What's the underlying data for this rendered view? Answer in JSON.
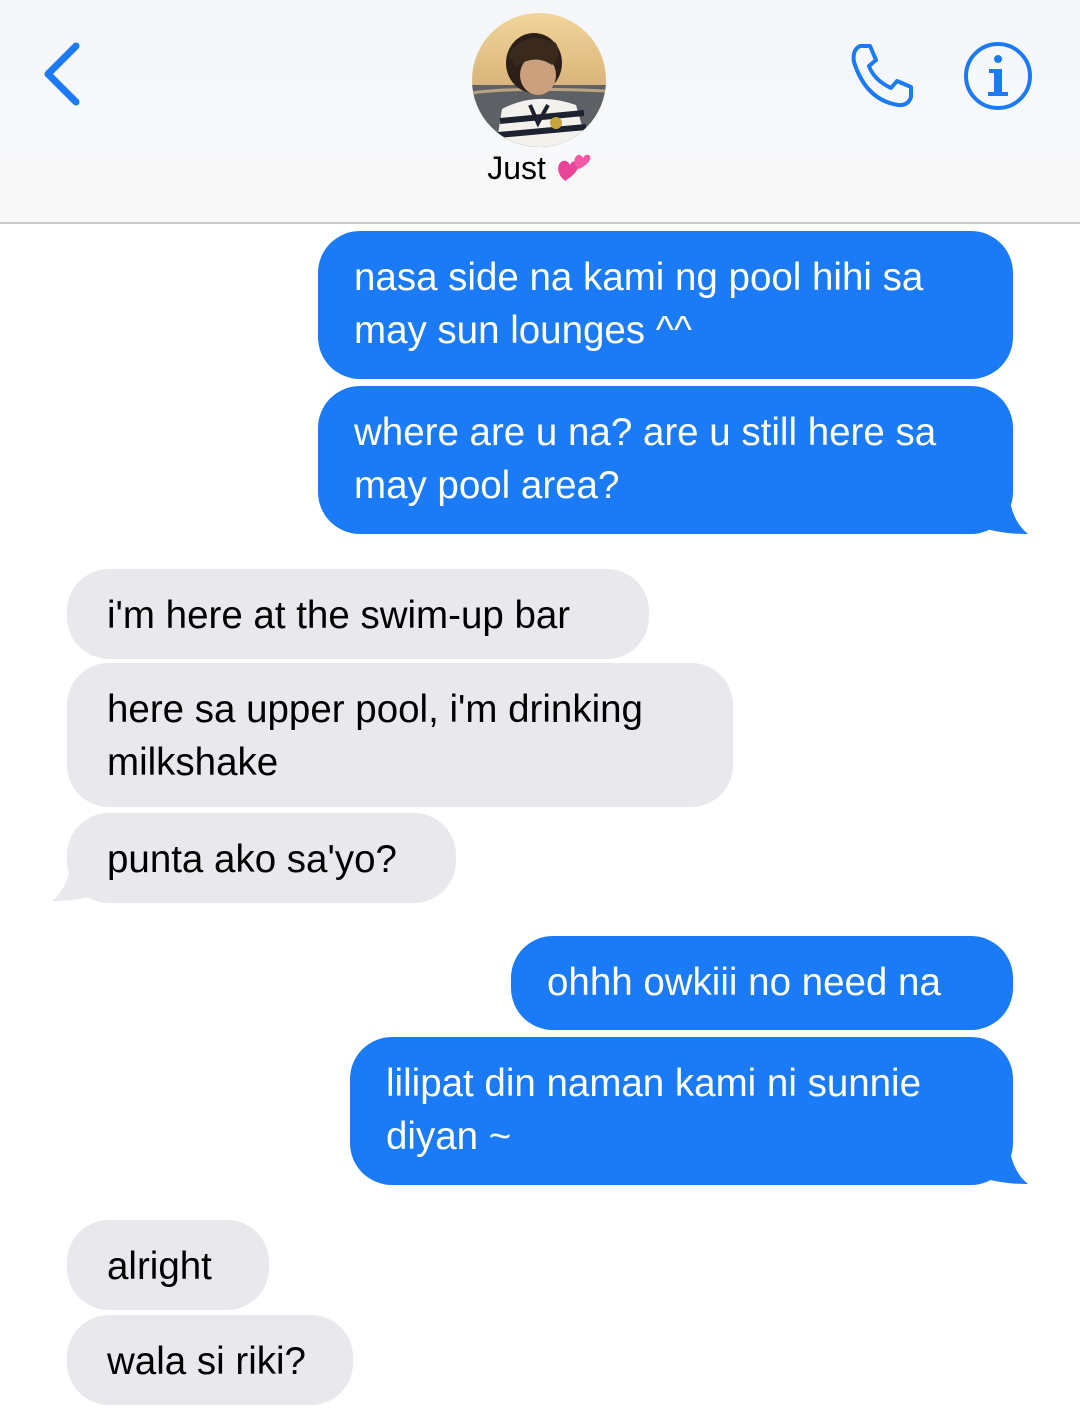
{
  "header": {
    "contact_name": "Just",
    "back_icon": "chevron-left-icon",
    "call_icon": "phone-icon",
    "info_icon": "info-icon",
    "accent_color": "#1b7bf6"
  },
  "messages": [
    {
      "direction": "outgoing",
      "lines": [
        "nasa side na kami ng pool hihi sa",
        "may sun lounges ^^"
      ]
    },
    {
      "direction": "outgoing",
      "lines": [
        "where are u na? are u still here sa",
        "may pool area?"
      ]
    },
    {
      "direction": "incoming",
      "lines": [
        "i'm here at the swim-up bar"
      ]
    },
    {
      "direction": "incoming",
      "lines": [
        "here sa upper pool, i'm drinking",
        "milkshake"
      ]
    },
    {
      "direction": "incoming",
      "lines": [
        "punta ako sa'yo?"
      ]
    },
    {
      "direction": "outgoing",
      "lines": [
        "ohhh owkiii no need na"
      ]
    },
    {
      "direction": "outgoing",
      "lines": [
        "lilipat din naman kami ni sunnie",
        "diyan ~"
      ]
    },
    {
      "direction": "incoming",
      "lines": [
        "alright"
      ]
    },
    {
      "direction": "incoming",
      "lines": [
        "wala si riki?"
      ]
    }
  ]
}
